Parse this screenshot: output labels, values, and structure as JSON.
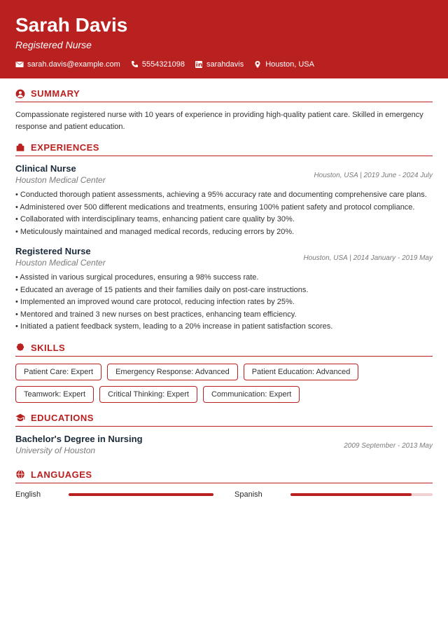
{
  "name": "Sarah Davis",
  "title": "Registered Nurse",
  "contacts": {
    "email": "sarah.davis@example.com",
    "phone": "5554321098",
    "linkedin": "sarahdavis",
    "location": "Houston, USA"
  },
  "sections": {
    "summary": "SUMMARY",
    "experiences": "EXPERIENCES",
    "skills": "SKILLS",
    "educations": "EDUCATIONS",
    "languages": "LANGUAGES"
  },
  "summary_text": "Compassionate registered nurse with 10 years of experience in providing high-quality patient care. Skilled in emergency response and patient education.",
  "experiences": [
    {
      "title": "Clinical Nurse",
      "company": "Houston Medical Center",
      "meta": "Houston, USA  |  2019 June - 2024 July",
      "bullets": [
        "• Conducted thorough patient assessments, achieving a 95% accuracy rate and documenting comprehensive care plans.",
        "• Administered over 500 different medications and treatments, ensuring 100% patient safety and protocol compliance.",
        "• Collaborated with interdisciplinary teams, enhancing patient care quality by 30%.",
        "• Meticulously maintained and managed medical records, reducing errors by 20%."
      ]
    },
    {
      "title": "Registered Nurse",
      "company": "Houston Medical Center",
      "meta": "Houston, USA  |  2014 January - 2019 May",
      "bullets": [
        "• Assisted in various surgical procedures, ensuring a 98% success rate.",
        "• Educated an average of 15 patients and their families daily on post-care instructions.",
        "• Implemented an improved wound care protocol, reducing infection rates by 25%.",
        "• Mentored and trained 3 new nurses on best practices, enhancing team efficiency.",
        "• Initiated a patient feedback system, leading to a 20% increase in patient satisfaction scores."
      ]
    }
  ],
  "skills": [
    "Patient Care: Expert",
    "Emergency Response: Advanced",
    "Patient Education: Advanced",
    "Teamwork: Expert",
    "Critical Thinking: Expert",
    "Communication: Expert"
  ],
  "education": {
    "degree": "Bachelor's Degree in Nursing",
    "school": "University of Houston",
    "meta": "2009 September - 2013 May"
  },
  "languages": [
    {
      "name": "English",
      "level": 100
    },
    {
      "name": "Spanish",
      "level": 85
    }
  ]
}
